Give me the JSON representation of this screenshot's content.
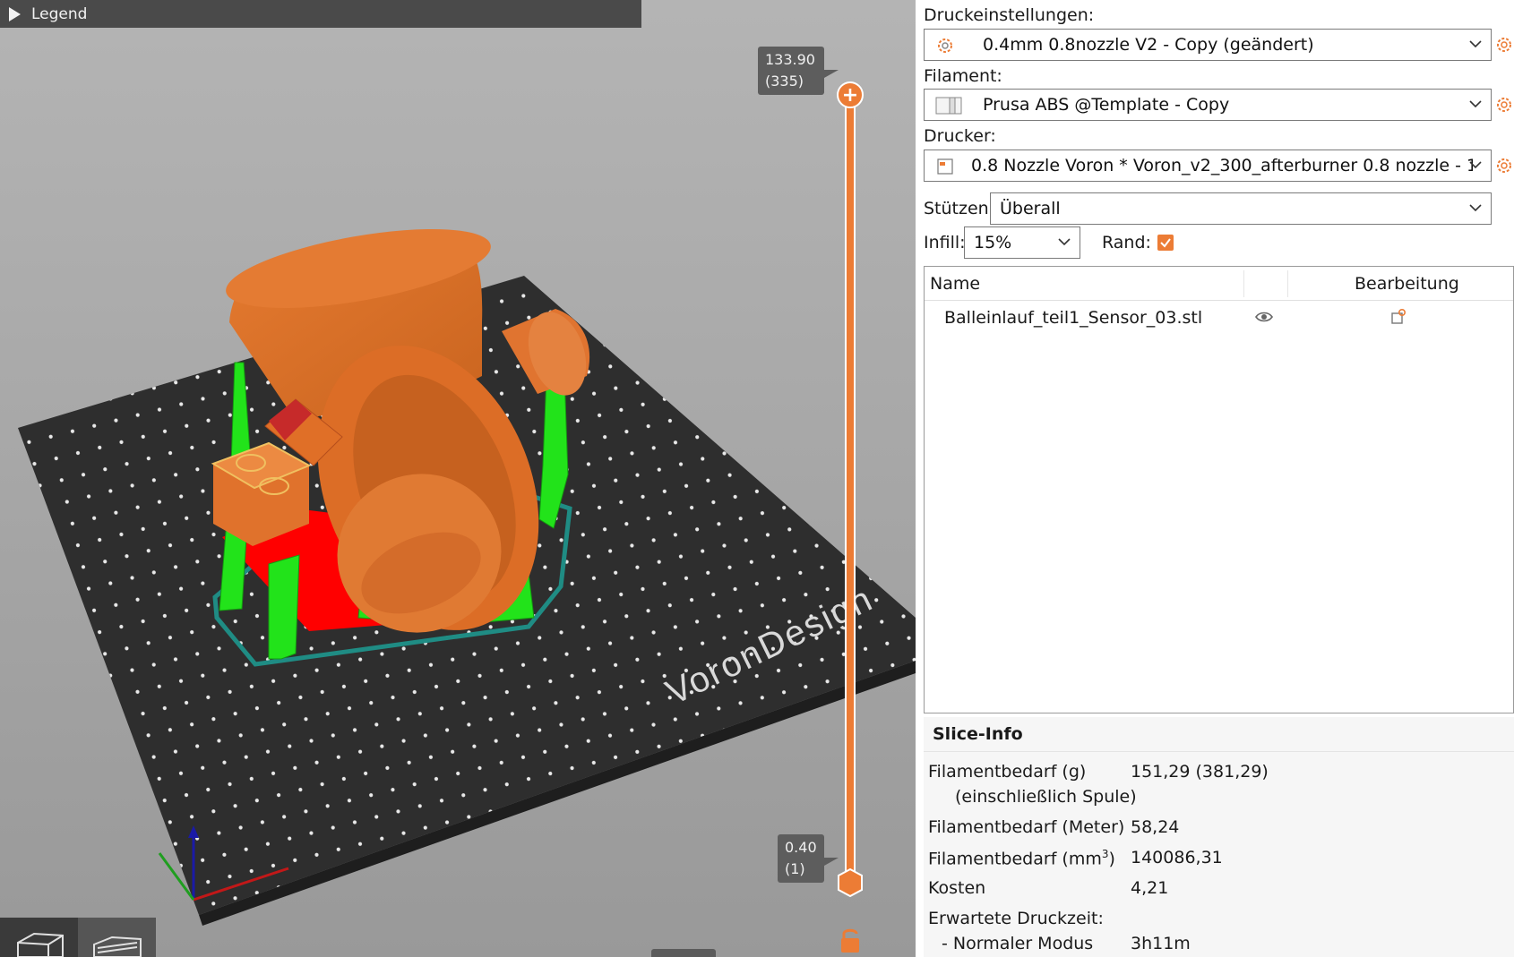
{
  "viewport": {
    "legend_label": "Legend",
    "bed_brand": "VoronDesign",
    "layer_slider": {
      "top_height": "133.90",
      "top_layer": "(335)",
      "bottom_height": "0.40",
      "bottom_layer": "(1)"
    }
  },
  "panel": {
    "print_settings": {
      "label": "Druckeinstellungen:",
      "value": "0.4mm 0.8nozzle V2 - Copy (geändert)"
    },
    "filament": {
      "label": "Filament:",
      "value": "Prusa ABS @Template - Copy"
    },
    "printer": {
      "label": "Drucker:",
      "value": "0.8 Nozzle Voron  * Voron_v2_300_afterburner 0.8 nozzle - 1. ..."
    },
    "supports": {
      "label": "Stützen:",
      "value": "Überall"
    },
    "infill": {
      "label": "Infill:",
      "value": "15%"
    },
    "brim": {
      "label": "Rand:",
      "checked": true
    },
    "objects": {
      "col_name": "Name",
      "col_edit": "Bearbeitung",
      "rows": [
        {
          "name": "Balleinlauf_teil1_Sensor_03.stl"
        }
      ]
    },
    "slice_info": {
      "title": "Slice-Info",
      "filament_g_label": "Filamentbedarf (g)",
      "filament_g_sub": "(einschließlich Spule)",
      "filament_g_value": "151,29 (381,29)",
      "filament_m_label": "Filamentbedarf (Meter)",
      "filament_m_value": "58,24",
      "filament_mm3_label": "Filamentbedarf (mm",
      "filament_mm3_sup": "3",
      "filament_mm3_close": ")",
      "filament_mm3_value": "140086,31",
      "cost_label": "Kosten",
      "cost_value": "4,21",
      "time_label": "Erwartete Druckzeit:",
      "normal_mode_label": "- Normaler Modus",
      "normal_mode_value": "3h11m"
    }
  },
  "colors": {
    "accent": "#ec7c35",
    "support": "#22e31a",
    "bed": "#2e2e2e",
    "interface": "#ff0000",
    "skirt": "#1f8c84"
  }
}
